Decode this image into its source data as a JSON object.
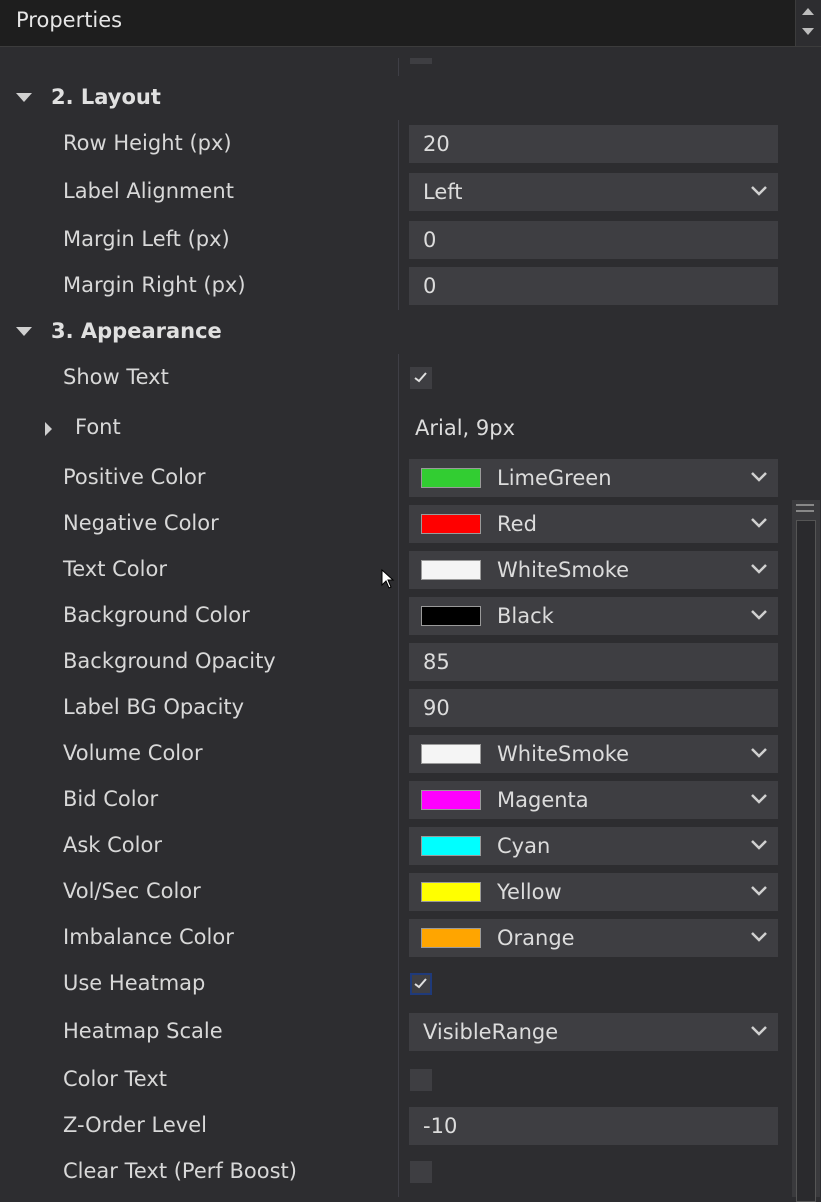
{
  "panel": {
    "title": "Properties"
  },
  "categories": {
    "layout": "2. Layout",
    "appearance": "3. Appearance"
  },
  "layout_rows": [
    {
      "label": "Row Height (px)",
      "value": "20"
    },
    {
      "label": "Label Alignment",
      "value": "Left"
    },
    {
      "label": "Margin Left (px)",
      "value": "0"
    },
    {
      "label": "Margin Right (px)",
      "value": "0"
    }
  ],
  "appearance": {
    "show_text": {
      "label": "Show Text",
      "checked": true
    },
    "font": {
      "label": "Font",
      "value": "Arial, 9px"
    },
    "positive_color": {
      "label": "Positive Color",
      "value": "LimeGreen",
      "color": "#32cd32"
    },
    "negative_color": {
      "label": "Negative Color",
      "value": "Red",
      "color": "#ff0000"
    },
    "text_color": {
      "label": "Text Color",
      "value": "WhiteSmoke",
      "color": "#f5f5f5"
    },
    "background_color": {
      "label": "Background Color",
      "value": "Black",
      "color": "#000000"
    },
    "background_opacity": {
      "label": "Background Opacity",
      "value": "85"
    },
    "label_bg_opacity": {
      "label": "Label BG Opacity",
      "value": "90"
    },
    "volume_color": {
      "label": "Volume Color",
      "value": "WhiteSmoke",
      "color": "#f5f5f5"
    },
    "bid_color": {
      "label": "Bid Color",
      "value": "Magenta",
      "color": "#ff00ff"
    },
    "ask_color": {
      "label": "Ask Color",
      "value": "Cyan",
      "color": "#00ffff"
    },
    "volsec_color": {
      "label": "Vol/Sec Color",
      "value": "Yellow",
      "color": "#ffff00"
    },
    "imbalance_color": {
      "label": "Imbalance Color",
      "value": "Orange",
      "color": "#ffa500"
    },
    "use_heatmap": {
      "label": "Use Heatmap",
      "checked": true
    },
    "heatmap_scale": {
      "label": "Heatmap Scale",
      "value": "VisibleRange"
    },
    "color_text": {
      "label": "Color Text",
      "checked": false
    },
    "z_order": {
      "label": "Z-Order Level",
      "value": "-10"
    },
    "clear_text": {
      "label": "Clear Text (Perf Boost)",
      "checked": false
    }
  }
}
